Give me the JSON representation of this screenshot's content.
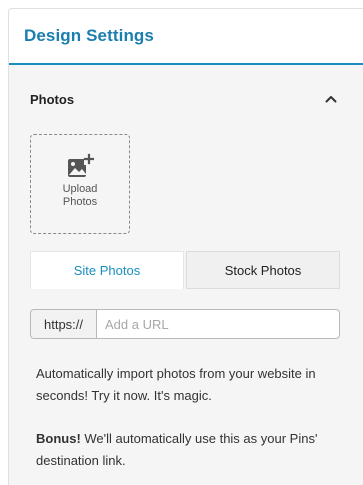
{
  "panel": {
    "title": "Design Settings",
    "accent_color": "#1a8fbf"
  },
  "photos_section": {
    "title": "Photos",
    "collapse_icon": "chevron-up-icon",
    "upload": {
      "icon": "add-photo-icon",
      "label_line1": "Upload",
      "label_line2": "Photos"
    },
    "tabs": [
      {
        "label": "Site Photos",
        "active": true
      },
      {
        "label": "Stock Photos",
        "active": false
      }
    ],
    "url_field": {
      "prefix": "https://",
      "placeholder": "Add a URL",
      "value": ""
    },
    "description": "Automatically import photos from your website in seconds! Try it now. It's magic.",
    "bonus_label": "Bonus!",
    "bonus_text": " We'll automatically use this as your Pins' destination link."
  }
}
